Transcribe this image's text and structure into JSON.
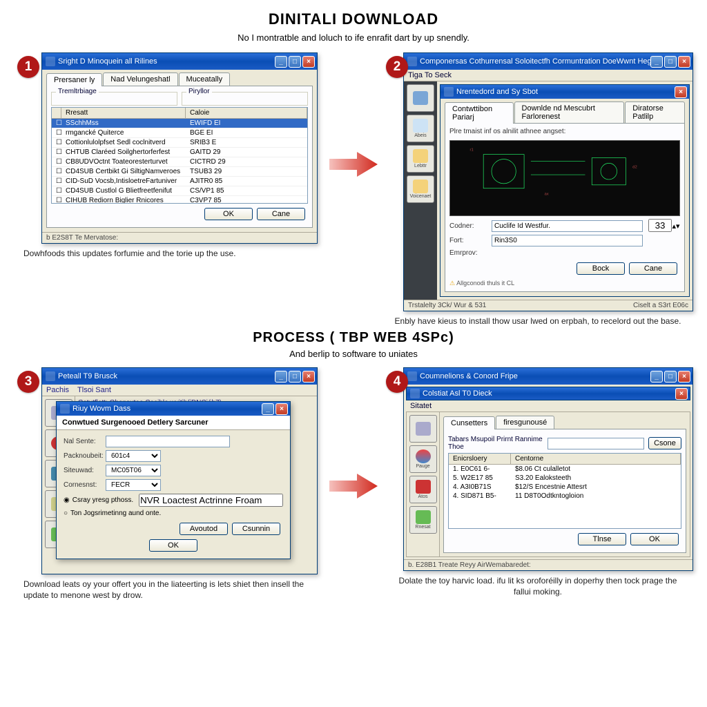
{
  "page": {
    "title": "DINITALI DOWNLOAD",
    "subtitle": "No I montratble and loluch to ife enrafit dart by up snendly.",
    "section_title": "PROCESS ( TBP WEB 4SPc)",
    "section_sub": "And berlip to software to uniates"
  },
  "badges": {
    "s1": "1",
    "s2": "2",
    "s3": "3",
    "s4": "4"
  },
  "step1": {
    "win_title": "Sright D Minoquein all Rilines",
    "tabs": [
      "Prersaner ly",
      "Nad Velungeshatl",
      "Muceatally"
    ],
    "group1": "Tremltrbiage",
    "group2": "Piryllor",
    "col_a": "Rresatt",
    "col_b": "Caloie",
    "rows": [
      {
        "a": "SSchhMss",
        "b": "EWIFD EI",
        "sel": true
      },
      {
        "a": "rmgancké Quiterce",
        "b": "BGE EI"
      },
      {
        "a": "Cottionlulolpfset Sedl coclnitverd",
        "b": "SRIB3 E"
      },
      {
        "a": "CHTUB Claréed Soilghertorferfest",
        "b": "GAITD 29"
      },
      {
        "a": "CB8UDVOctnt Toateoresterturvet",
        "b": "CICTRD 29"
      },
      {
        "a": "CD4SUB Certbikt Gi SiltigNamveroes",
        "b": "TSUB3 29"
      },
      {
        "a": "CID-SuD Vocsb,IntisloetreFartuniver",
        "b": "AJITR0 85"
      },
      {
        "a": "CD4SUB Custlol G Blietfreetfenifut",
        "b": "CS/VP1 85"
      },
      {
        "a": "CIHUB Rediorn Biglier Rnicores",
        "b": "C3VP7 85"
      }
    ],
    "ok": "OK",
    "cancel": "Cane",
    "status": "b E2S8T Te Mervatose:",
    "caption": "Dowhfoods this updates forfumie and the torie up the use."
  },
  "step2": {
    "win_title_outer": "Componersas Cothurrensal Soloitectfh Cormuntration DoeWwnt Hegle",
    "win_title_inner": "Nrentedord and Sy Sbot",
    "menu": "Tiga To Seck",
    "tabs": [
      "Contwttibon Pariarj",
      "Downlde nd Mescubrt Farlorenest",
      "Diratorse Patlilp"
    ],
    "hint": "Plre tmaist inf os alnilit athnee angset:",
    "codner": "Codner:",
    "fort": "Fort:",
    "emprov": "Emrprov:",
    "codner_v": "Cuclife Id Westfur.",
    "fort_v": "Rin3S0",
    "num": "33",
    "back": "Bock",
    "cancel": "Cane",
    "warn": "Allgconodi thuls it CL",
    "status_l": "Trstalelty 3Ck/ Wur & 531",
    "status_r": "Ciselt a S3rt E06c",
    "side": [
      "",
      "Abeis",
      "Lebttr",
      "Voicenaet"
    ],
    "caption": "Enbly have kieus to install thow usar lwed on erpbah, to recelord out the base."
  },
  "step3": {
    "win_title_back": "Peteall T9 Brusck",
    "menu_a": "Pachis",
    "menu_b": "Tlsoi Sant",
    "menu_line": "Cotutflatt; Obensuteo Casible wvitih(iDNCiéh7)",
    "win_title_front": "Riuy Wovm Dass",
    "header": "Conwtued Surgenooed Detlery Sarcuner",
    "nal": "Nal Sente:",
    "pack": "Packnoubeit:",
    "sieu": "Siteuwad:",
    "conn": "Cornesnst:",
    "nal_v": "",
    "pack_v": "601c4",
    "sieu_v": "MC05T06",
    "conn_v": "FECR",
    "radio1": "Csray yresg pthoss.",
    "radio1_v": "NVR Loactest Actrinne Froam",
    "radio2": "Ton Jogsrimetinng aund onte.",
    "accept": "Avoutod",
    "cancel": "Csunnin",
    "ok": "OK",
    "caption": "Download leats oy your offert you in the liateerting is lets shiet then insell the update to menone west by drow."
  },
  "step4": {
    "win_title_outer": "Coumnelions & Conord Fripe",
    "win_title_inner": "Colstiat Asl T0 Dieck",
    "menu_inner": "Sitatet",
    "tab_a": "Cunsetters",
    "tab_b": "firesgunousé",
    "top_label": "Tabars Msupoil Prirnt Rannime Thoe",
    "cancel": "Csone",
    "col_a": "Enicrsloery",
    "col_b": "Centorne",
    "rows": [
      {
        "a": "1.  E0C61 6-",
        "b": "$8.06 Ct culalletot"
      },
      {
        "a": "5.  W2E17 85",
        "b": "S3.20 Ealoksteeth"
      },
      {
        "a": "4.  A3I0B71S",
        "b": "$12/S Encestnie Attesrt"
      },
      {
        "a": "4.  SID871 B5-",
        "b": "11 D8T0Odtkntogloion"
      }
    ],
    "tbtn": "Tlnse",
    "ok": "OK",
    "status": "b. E28B1  Treate Reyy AirWemabaredet:",
    "side": [
      "",
      "Pauge",
      "Atos",
      "Rnesat"
    ],
    "caption": "Dolate the toy harvic load. ifu lit ks oroforéilly in doperhy then tock prage the fallui moking."
  }
}
